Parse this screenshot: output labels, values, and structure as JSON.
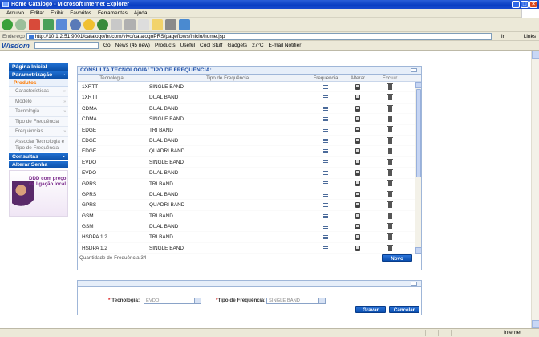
{
  "window": {
    "title": "Home Catalogo - Microsoft Internet Explorer"
  },
  "menu": [
    "Arquivo",
    "Editar",
    "Exibir",
    "Favoritos",
    "Ferramentas",
    "Ajuda"
  ],
  "address": {
    "label": "Endereço",
    "url": "http://10.1.2.51:9001/catalogo/br/com/vivo/catalogoPRS/pageflows/inicio/home.jsp",
    "go": "Ir",
    "links": "Links"
  },
  "toolbar2": {
    "logo": "Wisdom",
    "go": "Go",
    "news": "News (45 new)",
    "products": "Products",
    "useful": "Useful",
    "coolstuff": "Cool Stuff",
    "gadgets": "Gadgets",
    "temp": "27°C",
    "email": "E-mail Notifier"
  },
  "sidebar": {
    "pagina_inicial": "Página Inicial",
    "parametrizacao": "Parametrização",
    "produtos": "Produtos",
    "items": [
      "Características",
      "Modelo",
      "Tecnologia",
      "Tipo de Frequência",
      "Frequências"
    ],
    "assoc": "Associar Tecnologia e Tipo de Frequência",
    "consultas": "Consultas",
    "alterar_senha": "Alterar Senha",
    "ad_text": "DDD com preço de ligação local."
  },
  "consulta": {
    "title": "CONSULTA TECNOLOGIA/ TIPO DE FREQUÊNCIA:",
    "headers": {
      "tecnologia": "Tecnologia",
      "tipo": "Tipo de Frequência",
      "frequencia": "Frequencia",
      "alterar": "Alterar",
      "excluir": "Excluir"
    },
    "rows": [
      [
        "1XRTT",
        "SINGLE BAND"
      ],
      [
        "1XRTT",
        "DUAL BAND"
      ],
      [
        "CDMA",
        "DUAL BAND"
      ],
      [
        "CDMA",
        "SINGLE BAND"
      ],
      [
        "EDGE",
        "TRI BAND"
      ],
      [
        "EDGE",
        "DUAL BAND"
      ],
      [
        "EDGE",
        "QUADRI BAND"
      ],
      [
        "EVDO",
        "SINGLE BAND"
      ],
      [
        "EVDO",
        "DUAL BAND"
      ],
      [
        "GPRS",
        "TRI BAND"
      ],
      [
        "GPRS",
        "DUAL BAND"
      ],
      [
        "GPRS",
        "QUADRI BAND"
      ],
      [
        "GSM",
        "TRI BAND"
      ],
      [
        "GSM",
        "DUAL BAND"
      ],
      [
        "HSDPA 1.2",
        "TRI BAND"
      ],
      [
        "HSDPA 1.2",
        "SINGLE BAND"
      ]
    ],
    "quantidade": "Quantidade de Frequência:34",
    "novo": "Novo"
  },
  "form": {
    "tecnologia_label": "Tecnologia:",
    "tecnologia_value": "EVDO",
    "tipo_label": "Tipo de Frequência:",
    "tipo_value": "SINGLE BAND",
    "gravar": "Gravar",
    "cancelar": "Cancelar"
  },
  "status": {
    "zone": "Internet"
  }
}
